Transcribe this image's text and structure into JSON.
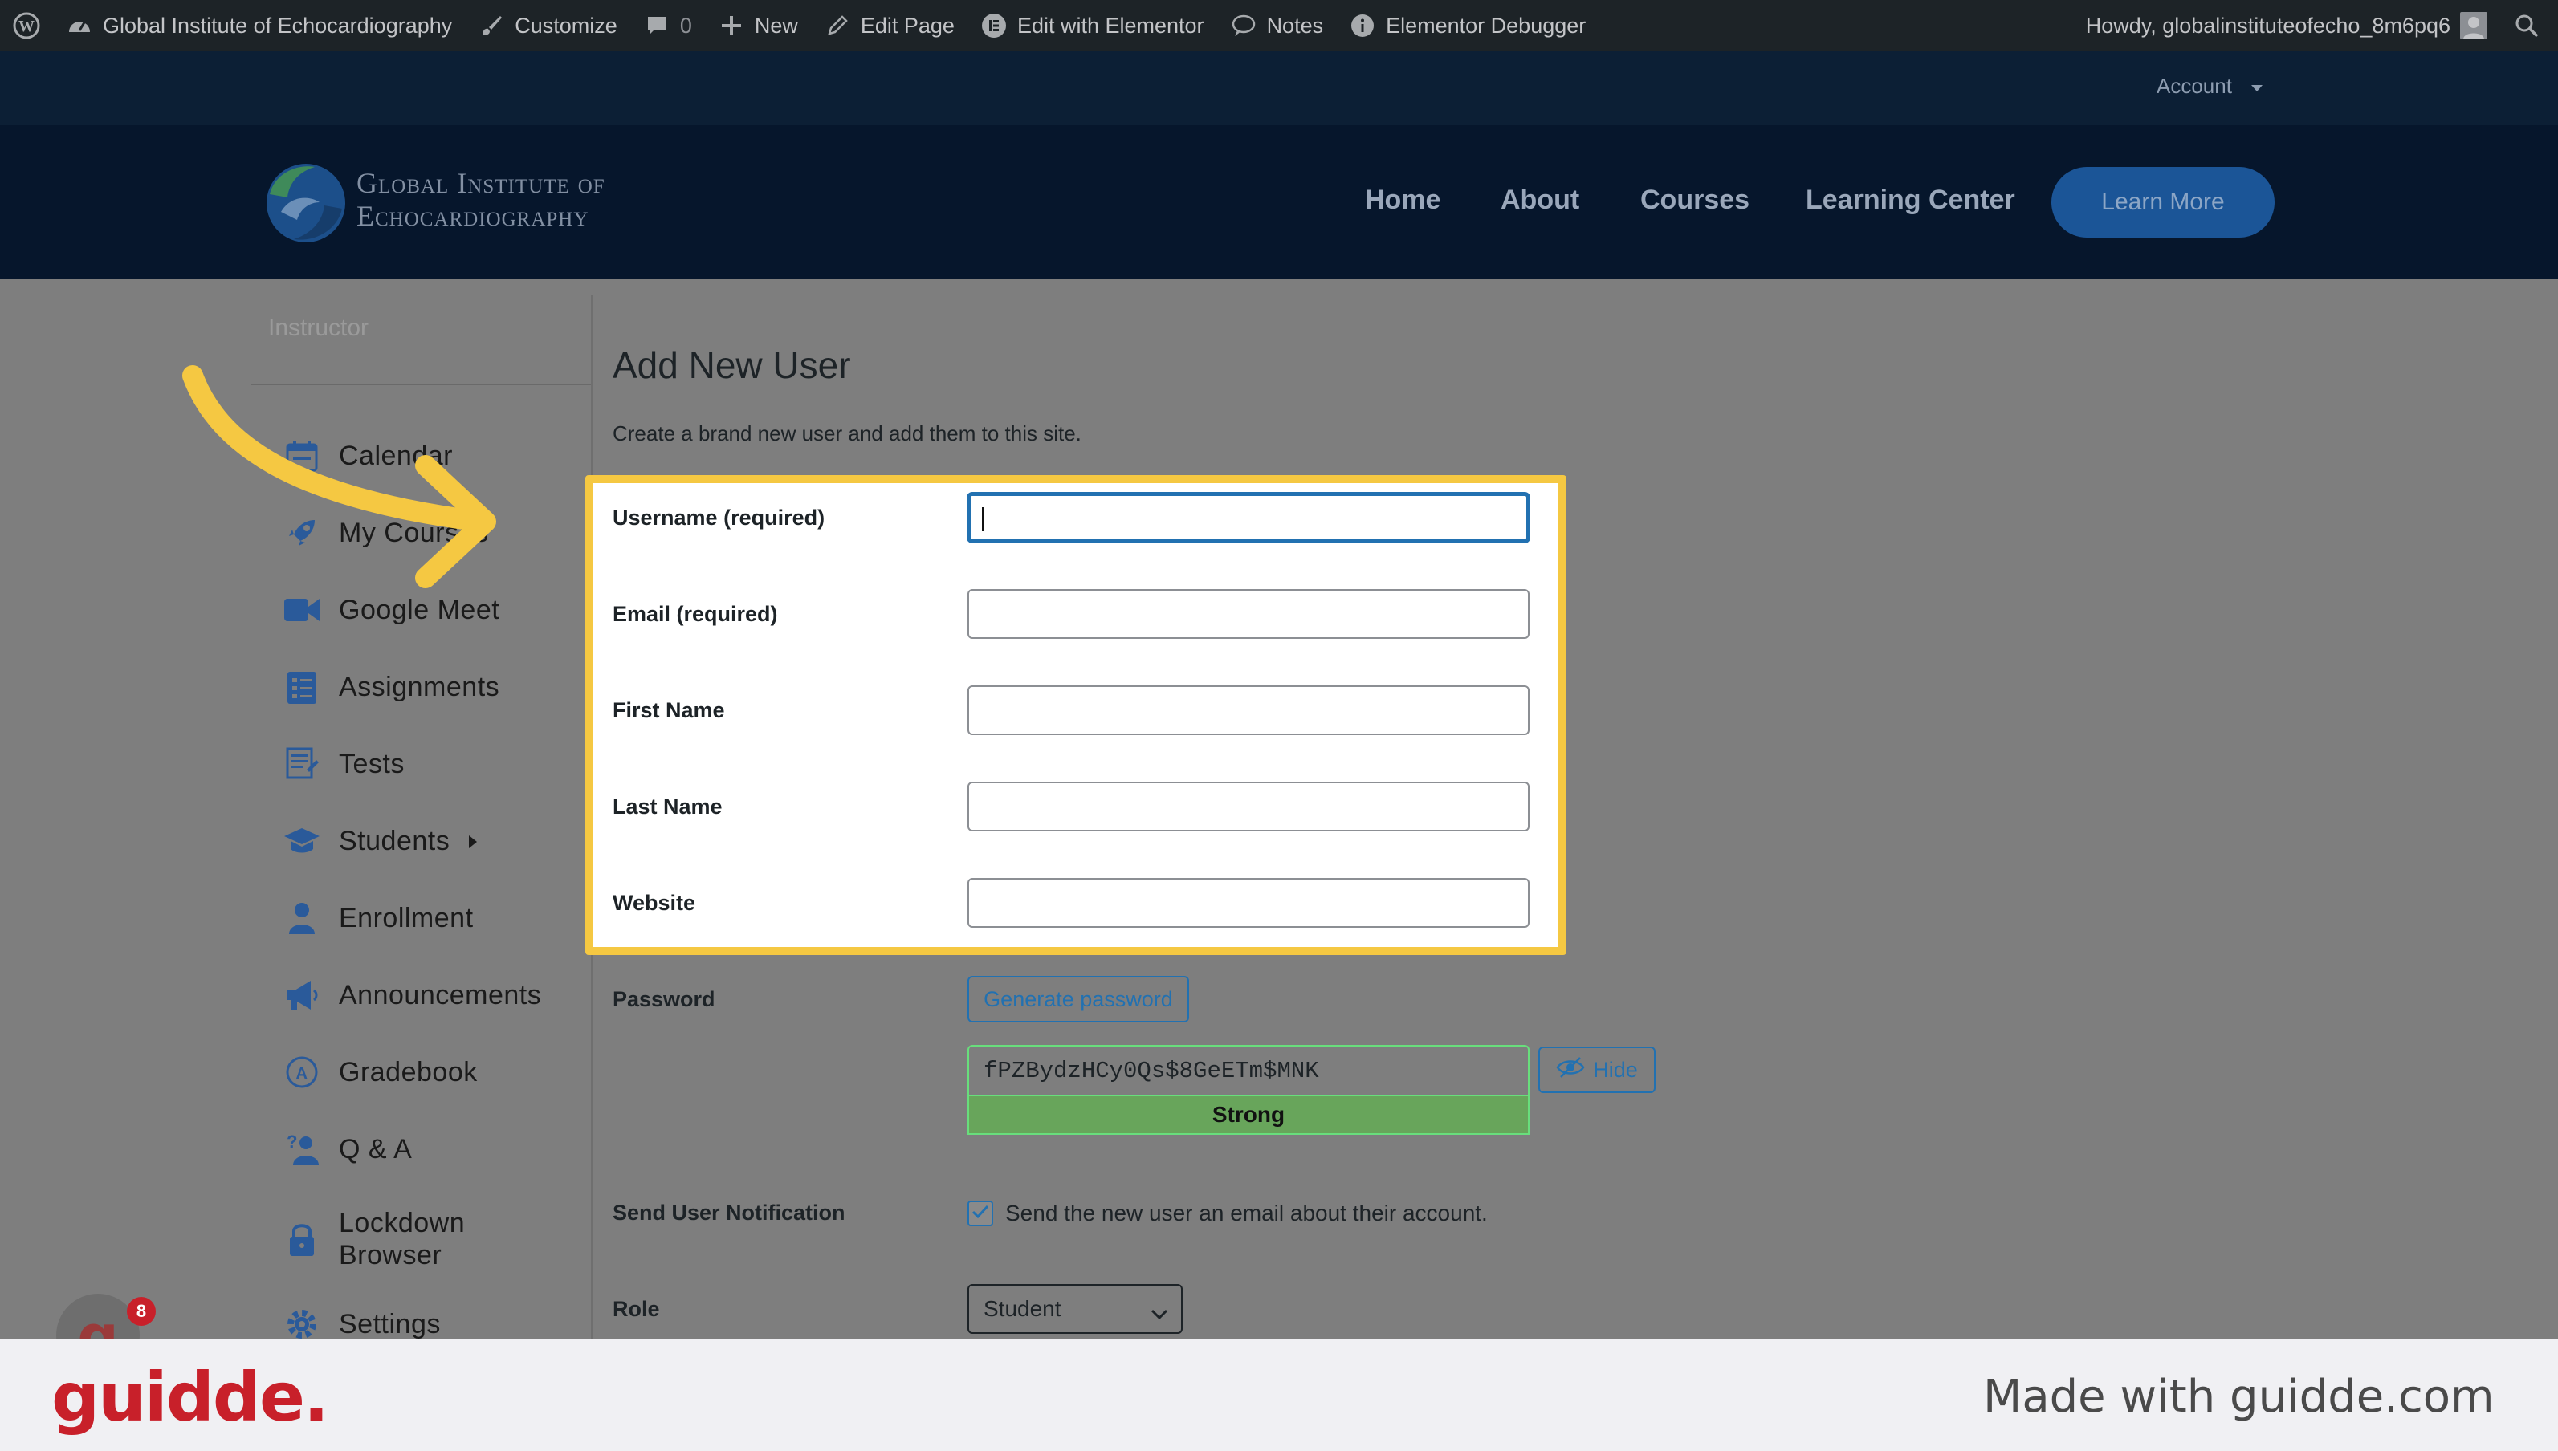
{
  "admin_bar": {
    "site_name": "Global Institute of Echocardiography",
    "customize": "Customize",
    "comments_count": "0",
    "new": "New",
    "edit_page": "Edit Page",
    "edit_elementor": "Edit with Elementor",
    "notes": "Notes",
    "debugger": "Elementor Debugger",
    "howdy": "Howdy, globalinstituteofecho_8m6pq6"
  },
  "account_menu": {
    "label": "Account"
  },
  "site_header": {
    "logo_line1": "Global Institute of",
    "logo_line2": "Echocardiography",
    "nav": [
      "Home",
      "About",
      "Courses",
      "Learning Center"
    ],
    "cta": "Learn More"
  },
  "sidebar": {
    "section_title": "Instructor",
    "items": [
      {
        "label": "Calendar",
        "icon": "calendar-icon"
      },
      {
        "label": "My Courses",
        "icon": "rocket-icon"
      },
      {
        "label": "Google Meet",
        "icon": "video-camera-icon"
      },
      {
        "label": "Assignments",
        "icon": "clipboard-list-icon"
      },
      {
        "label": "Tests",
        "icon": "test-sheet-icon"
      },
      {
        "label": "Students",
        "icon": "graduation-cap-icon"
      },
      {
        "label": "Enrollment",
        "icon": "user-icon"
      },
      {
        "label": "Announcements",
        "icon": "megaphone-icon"
      },
      {
        "label": "Gradebook",
        "icon": "grade-badge-icon"
      },
      {
        "label": "Q & A",
        "icon": "question-person-icon"
      },
      {
        "label": "Lockdown Browser",
        "icon": "lock-icon"
      },
      {
        "label": "Settings",
        "icon": "gear-icon"
      }
    ]
  },
  "main": {
    "title": "Add New User",
    "description": "Create a brand new user and add them to this site.",
    "fields": {
      "username": {
        "label": "Username (required)",
        "value": ""
      },
      "email": {
        "label": "Email (required)",
        "value": ""
      },
      "first_name": {
        "label": "First Name",
        "value": ""
      },
      "last_name": {
        "label": "Last Name",
        "value": ""
      },
      "website": {
        "label": "Website",
        "value": ""
      }
    },
    "password": {
      "label": "Password",
      "generate_button": "Generate password",
      "value": "fPZBydzHCy0Qs$8GeETm$MNK",
      "hide_button": "Hide",
      "strength": "Strong"
    },
    "notification": {
      "label": "Send User Notification",
      "checkbox_label": "Send the new user an email about their account.",
      "checked": true
    },
    "role": {
      "label": "Role",
      "selected": "Student"
    }
  },
  "notification_badge": {
    "count": "8"
  },
  "footer": {
    "brand": "guidde.",
    "made_with": "Made with guidde.com"
  },
  "colors": {
    "highlight": "#f5c842",
    "brand_red": "#c8202a",
    "wp_blue": "#2271b1",
    "header_bg": "#06162c"
  }
}
